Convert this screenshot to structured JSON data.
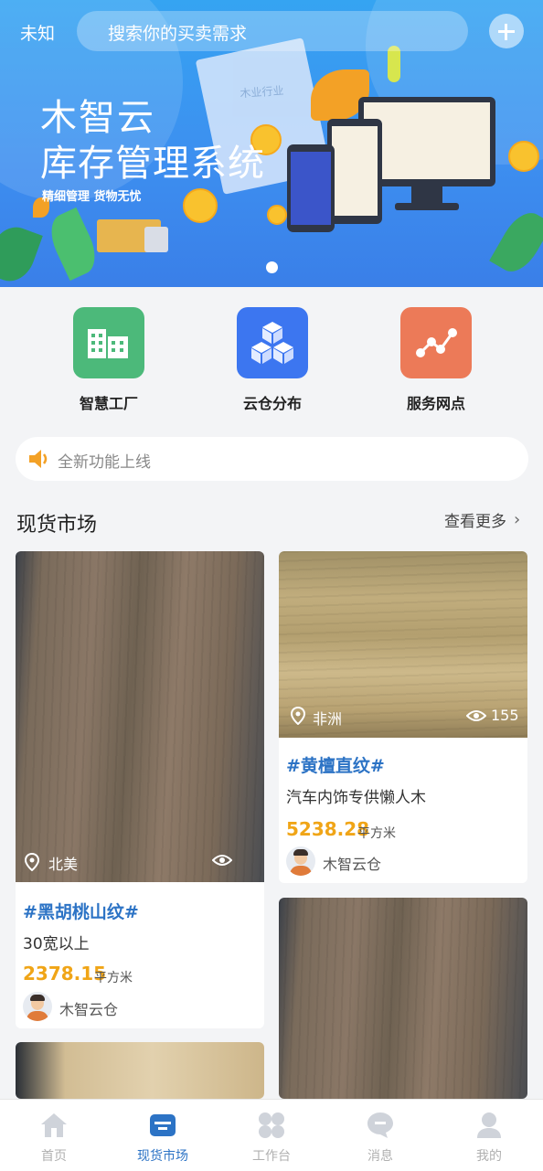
{
  "header": {
    "location": "未知",
    "search_placeholder": "搜索你的买卖需求",
    "add_icon": "plus-icon"
  },
  "banner": {
    "title_line1": "木智云",
    "title_line2": "库存管理系统",
    "subtitle": "精细管理  货物无忧",
    "paper_text": "木业行业",
    "page_count": 1,
    "active_page": 1
  },
  "quick_entries": [
    {
      "label": "智慧工厂",
      "icon": "factory-icon",
      "color": "#4cb97a"
    },
    {
      "label": "云仓分布",
      "icon": "cubes-icon",
      "color": "#3c76f0"
    },
    {
      "label": "服务网点",
      "icon": "network-nodes-icon",
      "color": "#ec7a58"
    }
  ],
  "notice": {
    "text": "全新功能上线",
    "icon": "speaker-icon"
  },
  "section": {
    "title": "现货市场",
    "more_label": "查看更多",
    "more_icon": "chevron-right-icon"
  },
  "products": [
    {
      "location": "北美",
      "views": "",
      "tag": "#黑胡桃山纹#",
      "desc": "30宽以上",
      "price": "2378.15",
      "unit": "平方米",
      "seller": "木智云仓"
    },
    {
      "location": "非洲",
      "views": "155",
      "tag": "#黄檀直纹#",
      "desc": "汽车内饰专供懒人木",
      "price": "5238.28",
      "unit": "平方米",
      "seller": "木智云仓"
    }
  ],
  "tabbar": [
    {
      "label": "首页",
      "icon": "home-icon",
      "active": false
    },
    {
      "label": "现货市场",
      "icon": "market-icon",
      "active": true
    },
    {
      "label": "工作台",
      "icon": "grid-icon",
      "active": false
    },
    {
      "label": "消息",
      "icon": "message-icon",
      "active": false
    },
    {
      "label": "我的",
      "icon": "user-icon",
      "active": false
    }
  ],
  "colors": {
    "brand": "#2c73c5",
    "price": "#f0a517",
    "banner_top": "#35a4f2",
    "banner_bottom": "#3a7fe8"
  }
}
